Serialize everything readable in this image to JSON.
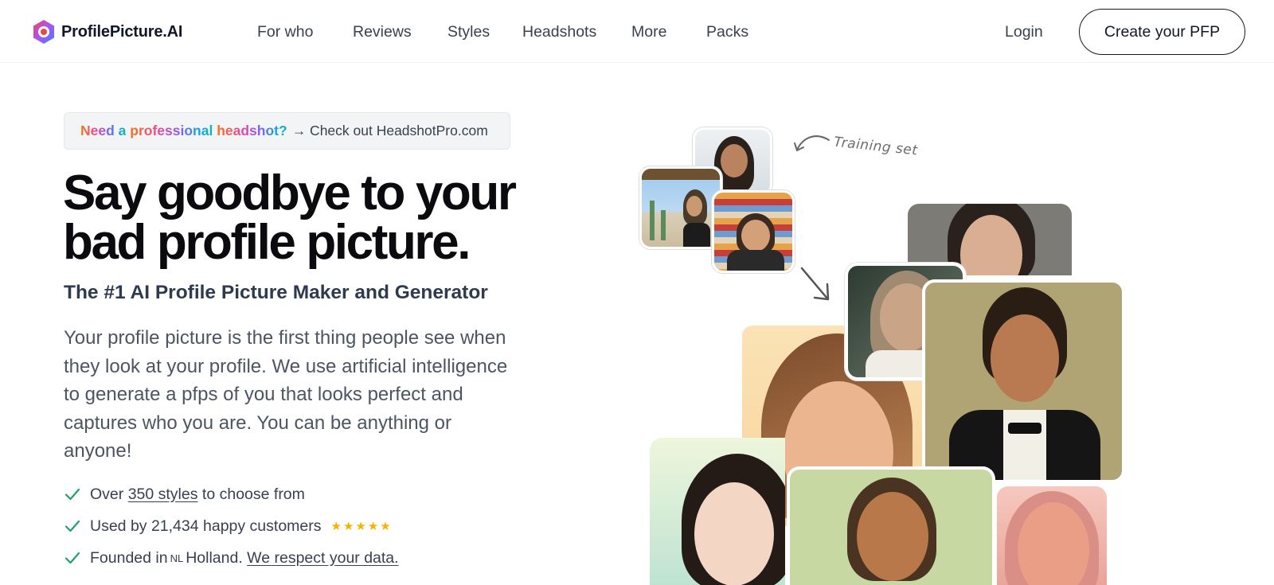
{
  "nav": {
    "brand": "ProfilePicture.AI",
    "links": [
      "For who",
      "Reviews",
      "Styles",
      "Headshots",
      "More",
      "Packs"
    ],
    "login": "Login",
    "cta": "Create your PFP"
  },
  "banner": {
    "word1": "Need a",
    "word2": "professional",
    "word3": "headshot?",
    "rest": "→ Check out HeadshotPro.com"
  },
  "hero": {
    "title_line1": "Say goodbye to your",
    "title_line2": "bad profile picture.",
    "subtitle": "The #1 AI Profile Picture Maker and Generator",
    "description": "Your profile picture is the first thing people see when they look at your profile. We use artificial intelligence to generate a pfps of you that looks perfect and captures who you are. You can be anything or anyone!"
  },
  "features": {
    "f1_pre": "Over",
    "f1_link": "350 styles",
    "f1_post": "to choose from",
    "f2": "Used by 21,434 happy customers",
    "f2_rating": 5,
    "f2_stars": "★★★★★",
    "f3_pre": "Founded in",
    "f3_flag": "NL",
    "f3_mid": "Holland.",
    "f3_link": "We respect your data."
  },
  "collage": {
    "annotation": "Training set"
  },
  "colors": {
    "accent_check": "#22a06b",
    "stars": "#f5b301",
    "text_dark": "#0b0b0f"
  }
}
